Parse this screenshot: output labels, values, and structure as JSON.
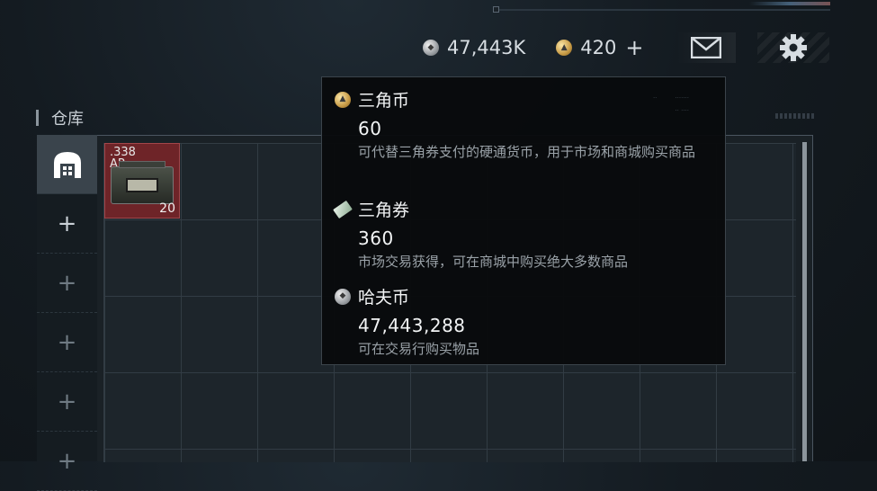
{
  "currency_bar": {
    "haf_amount": "47,443K",
    "tri_coin_amount": "420",
    "add_label": "+",
    "icons": [
      "haf-coin-icon",
      "tri-coin-icon",
      "mail-icon",
      "gear-icon"
    ]
  },
  "warehouse": {
    "title": "仓库",
    "tabs": [
      {
        "icon": "warehouse-icon",
        "label": ""
      },
      {
        "icon": "plus-icon",
        "label": "+"
      },
      {
        "icon": "plus-icon",
        "label": "+"
      },
      {
        "icon": "plus-icon",
        "label": "+"
      },
      {
        "icon": "plus-icon",
        "label": "+"
      },
      {
        "icon": "plus-icon",
        "label": "+"
      }
    ],
    "items": [
      {
        "caliber": ".338 AP",
        "caliber_line1": ".338",
        "caliber_line2": "AP",
        "count": "20",
        "rarity_color": "#6e2428"
      }
    ]
  },
  "tooltip": {
    "entries": [
      {
        "icon": "tri-coin-icon",
        "name": "三角币",
        "value": "60",
        "desc": "可代替三角券支付的硬通货币，用于市场和商城购买商品"
      },
      {
        "icon": "tri-ticket-icon",
        "name": "三角券",
        "value": "360",
        "desc": "市场交易获得，可在商城中购买绝大多数商品"
      },
      {
        "icon": "haf-coin-icon",
        "name": "哈夫币",
        "value": "47,443,288",
        "desc": "可在交易行购买物品"
      }
    ]
  },
  "colors": {
    "accent_gold": "#c79a45",
    "panel_bg": "#0a0c0e",
    "rarity_red": "#6e2428"
  }
}
